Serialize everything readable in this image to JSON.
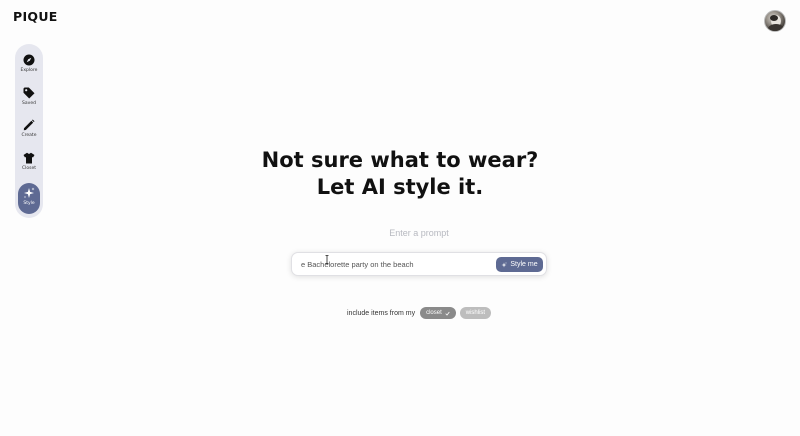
{
  "app": {
    "logo": "PIQUE"
  },
  "sidebar": {
    "items": [
      {
        "label": "Explore",
        "icon": "compass-icon"
      },
      {
        "label": "Saved",
        "icon": "tag-icon"
      },
      {
        "label": "Create",
        "icon": "pencil-icon"
      },
      {
        "label": "Closet",
        "icon": "shirt-icon"
      },
      {
        "label": "Style",
        "icon": "sparkle-icon",
        "active": true
      }
    ]
  },
  "hero": {
    "line1": "Not sure what to wear?",
    "line2": "Let AI style it."
  },
  "prompt": {
    "label": "Enter a prompt",
    "value": "e Bachelorette party on the beach",
    "button": "Style me"
  },
  "include": {
    "text": "include items from my",
    "chips": [
      {
        "label": "closet",
        "selected": true
      },
      {
        "label": "wishlist",
        "selected": false
      }
    ]
  },
  "colors": {
    "accent": "#5e6a93",
    "sidebar_bg": "#e6e7ef",
    "chip_selected": "#8a8a8a",
    "chip_unselected": "#bdbdbd"
  }
}
